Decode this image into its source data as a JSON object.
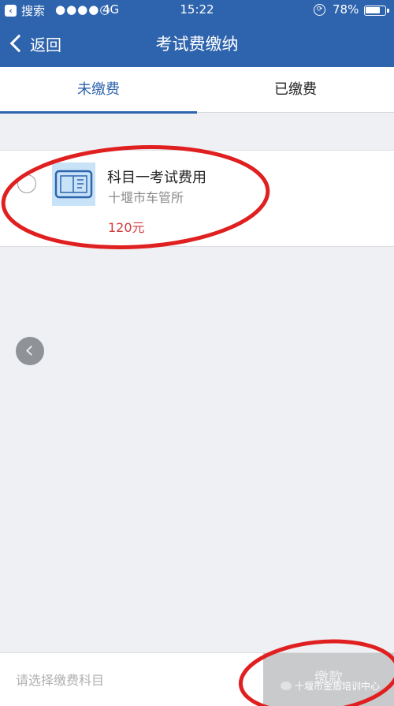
{
  "status_bar": {
    "app": "搜索",
    "signal": "●●●●○",
    "network": "4G",
    "time": "15:22",
    "battery": "78%",
    "battery_level": 0.78
  },
  "nav": {
    "back_label": "返回",
    "title": "考试费缴纳"
  },
  "tabs": [
    {
      "label": "未缴费",
      "active": true
    },
    {
      "label": "已缴费",
      "active": false
    }
  ],
  "fee_item": {
    "title": "科目一考试费用",
    "office": "十堰市车管所",
    "price": "120元"
  },
  "bottom": {
    "hint": "请选择缴费科目",
    "pay_label": "缴款"
  },
  "watermark": "十堰市金盾培训中心",
  "colors": {
    "brand": "#2e64ad",
    "price": "#d23a3a",
    "annotation": "#e02020",
    "pay_disabled": "#c9cacc"
  }
}
